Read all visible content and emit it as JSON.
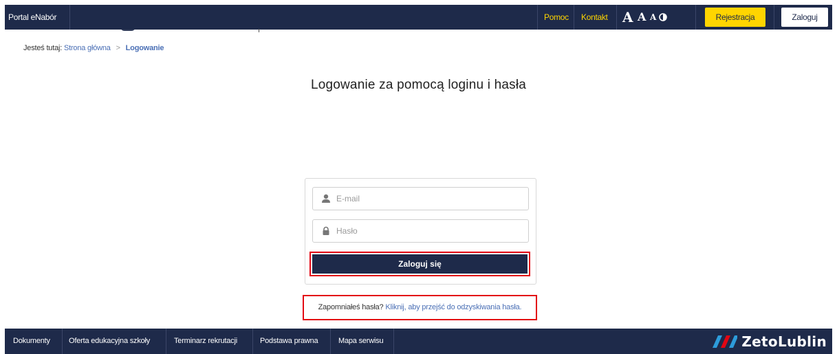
{
  "header": {
    "brand": "Portal eNabór",
    "help": "Pomoc",
    "contact": "Kontakt",
    "font_large": "A",
    "font_medium": "A",
    "font_small": "A",
    "contrast_icon": "contrast-icon",
    "register": "Rejestracja",
    "login": "Zaloguj"
  },
  "breadcrumb": {
    "prefix": "Jesteś tutaj:",
    "home": "Strona główna",
    "separator": ">",
    "current": "Logowanie"
  },
  "page": {
    "title": "Logowanie za pomocą loginu i hasła"
  },
  "login_form": {
    "email_placeholder": "E-mail",
    "email_value": "",
    "email_icon": "user-icon",
    "password_placeholder": "Hasło",
    "password_value": "",
    "password_icon": "lock-icon",
    "submit": "Zaloguj się"
  },
  "forgot": {
    "question": "Zapomniałeś hasła?",
    "link": "Kliknij, aby przejść do odzyskiwania hasła."
  },
  "footer": {
    "items": [
      "Dokumenty",
      "Oferta edukacyjna szkoły",
      "Terminarz rekrutacji",
      "Podstawa prawna",
      "Mapa serwisu"
    ],
    "logo_text": "ZetoLublin"
  },
  "colors": {
    "navy": "#1e2a4a",
    "accent_yellow": "#ffd500",
    "link_blue": "#4a6fb5",
    "highlight_red": "#e30613"
  }
}
